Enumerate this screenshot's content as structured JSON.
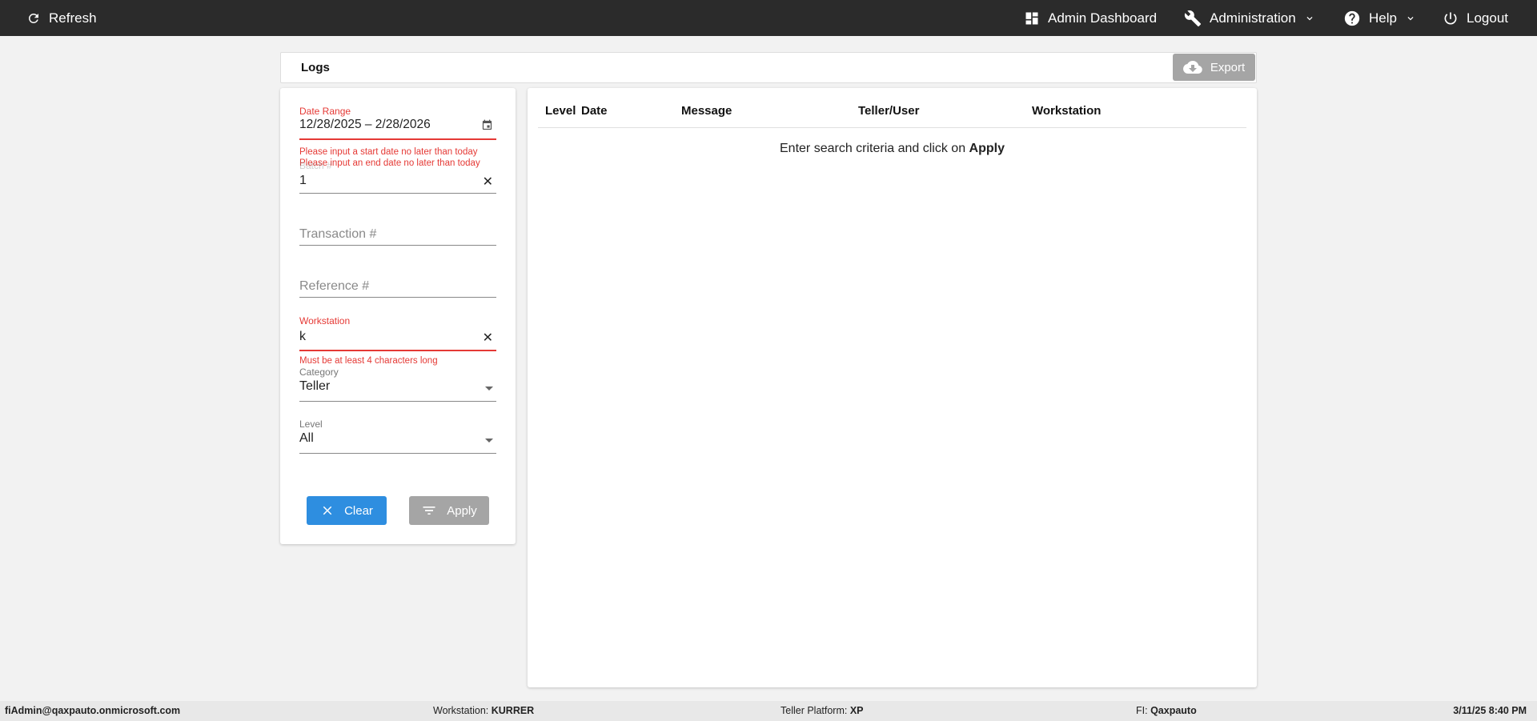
{
  "topbar": {
    "refresh_label": "Refresh",
    "dashboard_label": "Admin Dashboard",
    "administration_label": "Administration",
    "help_label": "Help",
    "logout_label": "Logout"
  },
  "page": {
    "title": "Logs",
    "export_label": "Export"
  },
  "filters": {
    "date_range": {
      "label": "Date Range",
      "value": "12/28/2025 – 2/28/2026",
      "error_start": "Please input a start date no later than today",
      "error_end": "Please input an end date no later than today"
    },
    "batch": {
      "label": "Batch #",
      "value": "1"
    },
    "transaction": {
      "placeholder": "Transaction #"
    },
    "reference": {
      "placeholder": "Reference #"
    },
    "workstation": {
      "label": "Workstation",
      "value": "k",
      "error": "Must be at least 4 characters long"
    },
    "category": {
      "label": "Category",
      "value": "Teller"
    },
    "level": {
      "label": "Level",
      "value": "All"
    },
    "clear_label": "Clear",
    "apply_label": "Apply"
  },
  "results": {
    "columns": [
      "Level",
      "Date",
      "Message",
      "Teller/User",
      "Workstation"
    ],
    "empty_prefix": "Enter search criteria and click on ",
    "empty_action": "Apply"
  },
  "statusbar": {
    "user": "fiAdmin@qaxpauto.onmicrosoft.com",
    "workstation_label": "Workstation:",
    "workstation_value": "KURRER",
    "platform_label": "Teller Platform:",
    "platform_value": "XP",
    "fi_label": "FI:",
    "fi_value": "Qaxpauto",
    "datetime": "3/11/25 8:40 PM"
  },
  "colors": {
    "topbar_bg": "#2b2b2b",
    "error": "#e53935",
    "primary_button": "#2e8ee0",
    "disabled_button": "#a5a5a5"
  }
}
